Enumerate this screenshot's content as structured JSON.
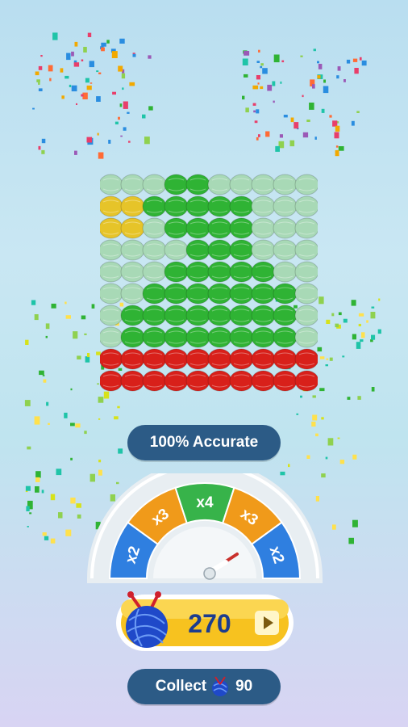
{
  "accuracy_label": "100% Accurate",
  "multiplier_meter": {
    "segments": [
      {
        "label": "x2",
        "color": "#2f7fe0"
      },
      {
        "label": "x3",
        "color": "#f09a1a"
      },
      {
        "label": "x4",
        "color": "#37b34a"
      },
      {
        "label": "x3",
        "color": "#f09a1a"
      },
      {
        "label": "x2",
        "color": "#2f7fe0"
      }
    ],
    "needle_icon": "needle-pointer-icon"
  },
  "reward": {
    "amount": "270",
    "yarn_icon": "blue-yarn-ball-icon",
    "ad_icon": "play-video-icon"
  },
  "collect": {
    "label": "Collect",
    "amount": "90",
    "yarn_icon": "blue-yarn-ball-icon"
  },
  "knit_pattern": {
    "colors": {
      "G": "#a8d9b6",
      "B": "#2fb334",
      "Y": "#e6c429",
      "R": "#d8201a"
    },
    "rows": [
      "GGGBBGGGGG",
      "YYBBBBBGGG",
      "YYGBBBBGGG",
      "GGGGBBBGGG",
      "GGGBBBBBGG",
      "GGBBBBBBBG",
      "GBBBBBBBBG",
      "GBBBBBBBBG",
      "RRRRRRRRRR",
      "RRRRRRRRRR"
    ]
  }
}
